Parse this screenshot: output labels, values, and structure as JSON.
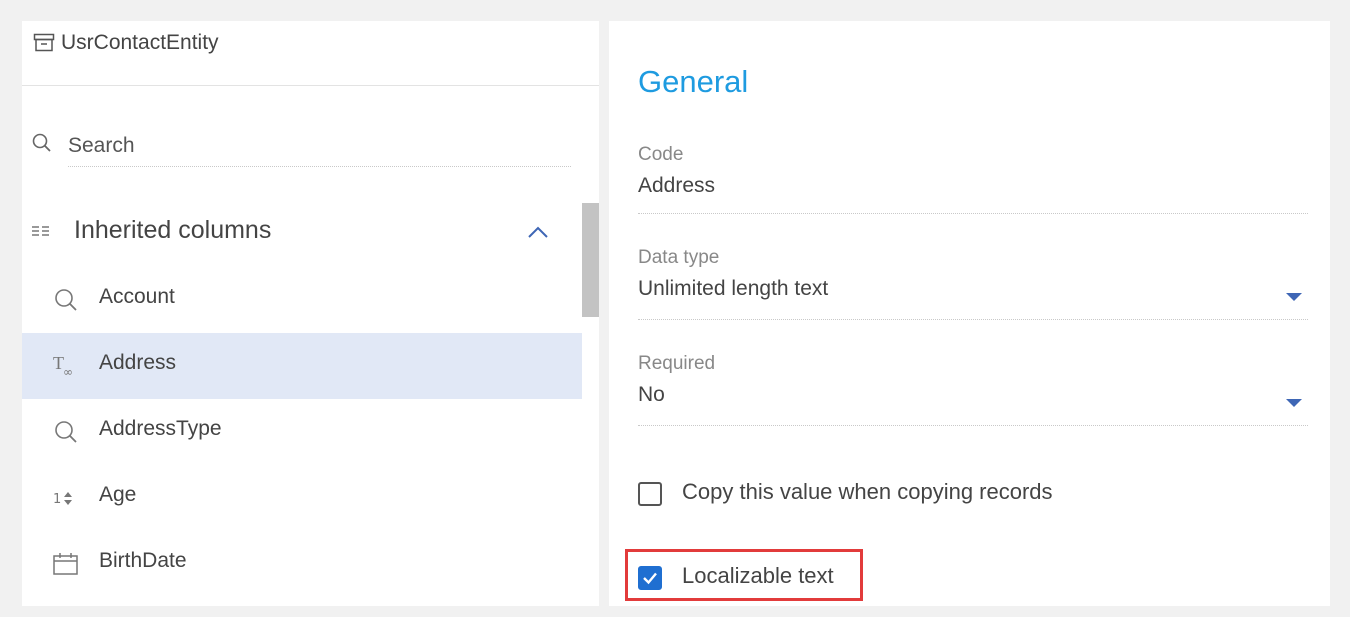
{
  "entity": {
    "title": "UsrContactEntity",
    "icon": "archive-box-icon"
  },
  "search": {
    "placeholder": "Search"
  },
  "group": {
    "label": "Inherited columns",
    "expanded": true
  },
  "columns": [
    {
      "label": "Account",
      "icon": "lookup-icon",
      "selected": false
    },
    {
      "label": "Address",
      "icon": "text-type-icon",
      "selected": true
    },
    {
      "label": "AddressType",
      "icon": "lookup-icon",
      "selected": false
    },
    {
      "label": "Age",
      "icon": "integer-type-icon",
      "selected": false
    },
    {
      "label": "BirthDate",
      "icon": "calendar-icon",
      "selected": false
    }
  ],
  "panel": {
    "title": "General",
    "code": {
      "label": "Code",
      "value": "Address"
    },
    "data_type": {
      "label": "Data type",
      "value": "Unlimited length text"
    },
    "required": {
      "label": "Required",
      "value": "No"
    },
    "copy_value": {
      "label": "Copy this value when copying records",
      "checked": false
    },
    "localizable": {
      "label": "Localizable text",
      "checked": true
    }
  },
  "colors": {
    "accent": "#1e9be0",
    "selection": "#e1e8f6",
    "highlight_border": "#e23b3b",
    "checkbox": "#1f6fd1"
  }
}
